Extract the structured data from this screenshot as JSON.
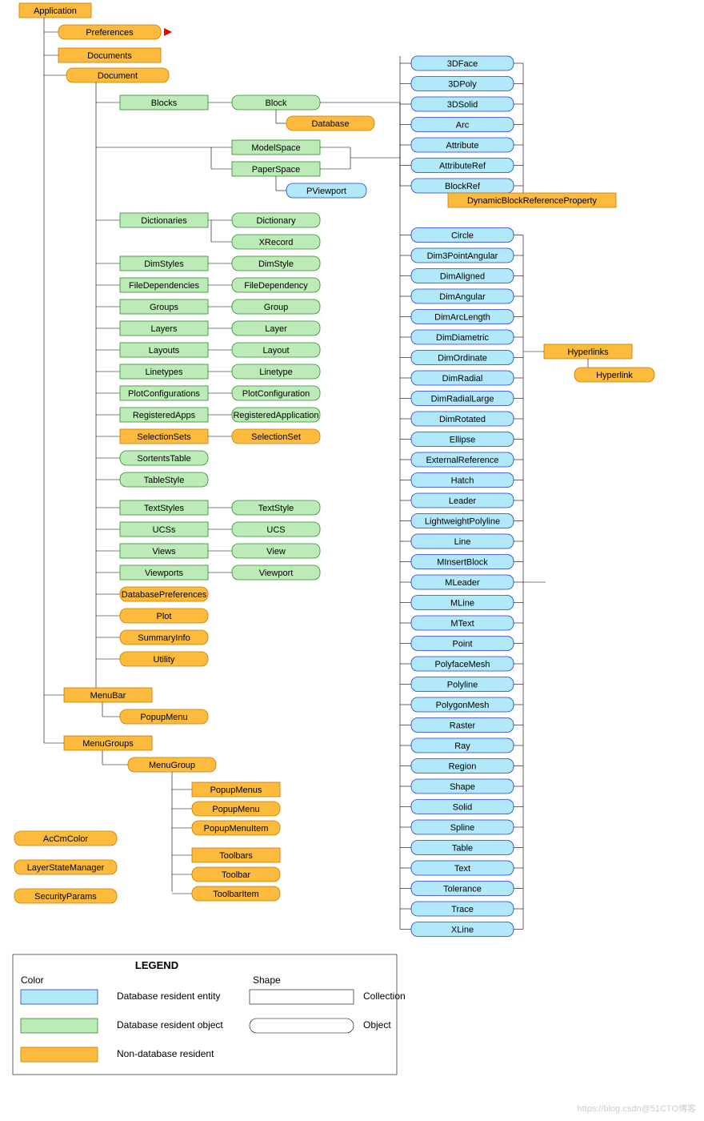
{
  "root": "Application",
  "app_children": {
    "preferences": "Preferences",
    "documents": "Documents",
    "document": "Document"
  },
  "blocks": {
    "col": "Blocks",
    "item": "Block",
    "db": "Database"
  },
  "modelSpace": "ModelSpace",
  "paperSpace": "PaperSpace",
  "pviewport": "PViewport",
  "pairs": [
    {
      "col": "Dictionaries",
      "item": "Dictionary",
      "extra": "XRecord"
    },
    {
      "col": "DimStyles",
      "item": "DimStyle"
    },
    {
      "col": "FileDependencies",
      "item": "FileDependency"
    },
    {
      "col": "Groups",
      "item": "Group"
    },
    {
      "col": "Layers",
      "item": "Layer"
    },
    {
      "col": "Layouts",
      "item": "Layout"
    },
    {
      "col": "Linetypes",
      "item": "Linetype"
    },
    {
      "col": "PlotConfigurations",
      "item": "PlotConfiguration"
    },
    {
      "col": "RegisteredApps",
      "item": "RegisteredApplication"
    }
  ],
  "selSets": {
    "col": "SelectionSets",
    "item": "SelectionSet"
  },
  "solo": [
    "SortentsTable",
    "TableStyle"
  ],
  "pairs2": [
    {
      "col": "TextStyles",
      "item": "TextStyle"
    },
    {
      "col": "UCSs",
      "item": "UCS"
    },
    {
      "col": "Views",
      "item": "View"
    },
    {
      "col": "Viewports",
      "item": "Viewport"
    }
  ],
  "docOrange": [
    "DatabasePreferences",
    "Plot",
    "SummaryInfo",
    "Utility"
  ],
  "menuBar": "MenuBar",
  "popupMenu": "PopupMenu",
  "menuGroups": "MenuGroups",
  "menuGroup": "MenuGroup",
  "mgChildren": [
    "PopupMenus",
    "PopupMenu",
    "PopupMenuItem"
  ],
  "toolbars": [
    "Toolbars",
    "Toolbar",
    "ToolbarItem"
  ],
  "standalone": [
    "AcCmColor",
    "LayerStateManager",
    "SecurityParams"
  ],
  "entities": [
    "3DFace",
    "3DPoly",
    "3DSolid",
    "Arc",
    "Attribute",
    "AttributeRef",
    "BlockRef"
  ],
  "dynprop": "DynamicBlockReferenceProperty",
  "entities2": [
    "Circle",
    "Dim3PointAngular",
    "DimAligned",
    "DimAngular",
    "DimArcLength",
    "DimDiametric",
    "DimOrdinate",
    "DimRadial",
    "DimRadialLarge",
    "DimRotated",
    "Ellipse",
    "ExternalReference",
    "Hatch",
    "Leader",
    "LightweightPolyline",
    "Line",
    "MInsertBlock",
    "MLeader",
    "MLine",
    "MText",
    "Point",
    "PolyfaceMesh",
    "Polyline",
    "PolygonMesh",
    "Raster",
    "Ray",
    "Region",
    "Shape",
    "Solid",
    "Spline",
    "Table",
    "Text",
    "Tolerance",
    "Trace",
    "XLine"
  ],
  "hyperlinks": "Hyperlinks",
  "hyperlink": "Hyperlink",
  "legend": {
    "title": "LEGEND",
    "color": "Color",
    "shape": "Shape",
    "entity": "Database resident entity",
    "object": "Database resident object",
    "nondb": "Non-database  resident",
    "collection": "Collection",
    "objectShape": "Object"
  },
  "watermark": "https://blog.csdn@51CTO博客"
}
